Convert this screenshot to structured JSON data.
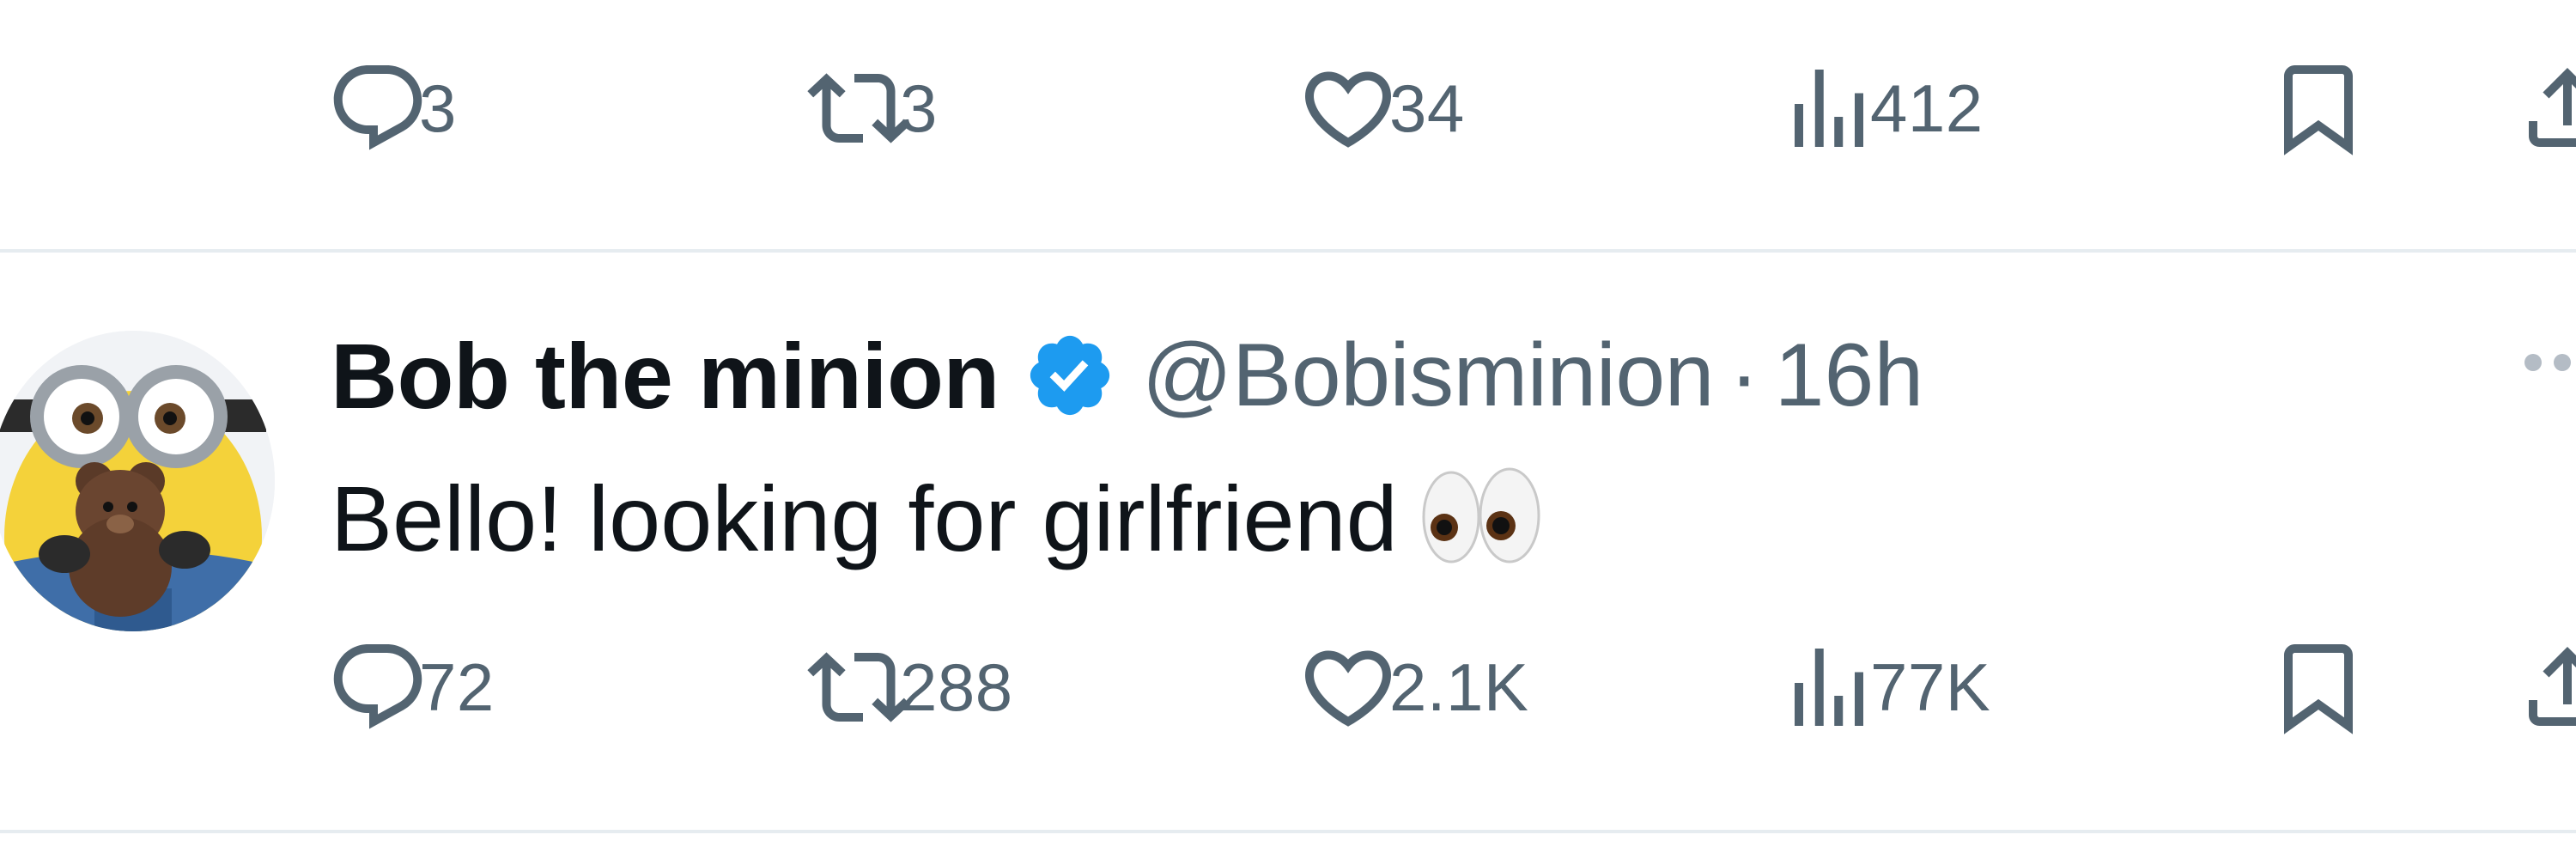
{
  "previous_tweet": {
    "actions": {
      "reply_count": "3",
      "repost_count": "3",
      "like_count": "34",
      "view_count": "412"
    }
  },
  "tweet": {
    "display_name": "Bob the minion",
    "handle": "@Bobisminion",
    "separator": "·",
    "time": "16h",
    "text": "Bello! looking for girlfriend",
    "emoji": "eyes",
    "verified": true,
    "actions": {
      "reply_count": "72",
      "repost_count": "288",
      "like_count": "2.1K",
      "view_count": "77K"
    }
  },
  "colors": {
    "icon_gray": "#536471",
    "text_primary": "#0f1419",
    "verified_blue": "#1d9bf0",
    "divider": "#e6ecf0"
  },
  "icons": {
    "reply": "reply-icon",
    "repost": "repost-icon",
    "like": "heart-icon",
    "views": "views-icon",
    "bookmark": "bookmark-icon",
    "share": "share-icon",
    "verified": "verified-badge-icon",
    "more": "more-icon"
  }
}
